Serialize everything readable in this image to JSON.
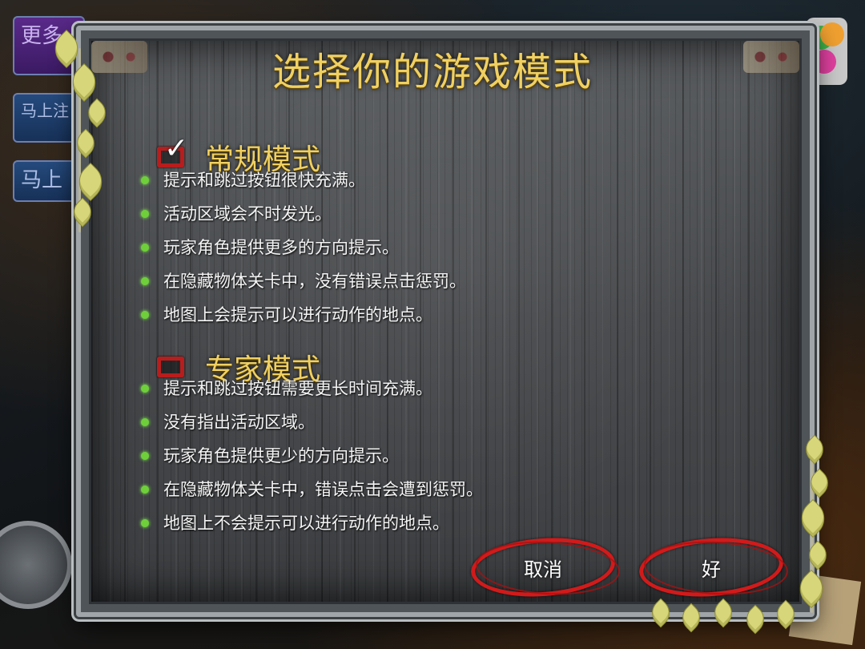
{
  "background": {
    "more_games_label": "更多",
    "register_label_1": "马上注",
    "register_label_2": "马上"
  },
  "dialog": {
    "title": "选择你的游戏模式",
    "modes": [
      {
        "label": "常规模式",
        "checked": true,
        "features": [
          "提示和跳过按钮很快充满。",
          "活动区域会不时发光。",
          "玩家角色提供更多的方向提示。",
          "在隐藏物体关卡中，没有错误点击惩罚。",
          "地图上会提示可以进行动作的地点。"
        ]
      },
      {
        "label": "专家模式",
        "checked": false,
        "features": [
          "提示和跳过按钮需要更长时间充满。",
          "没有指出活动区域。",
          "玩家角色提供更少的方向提示。",
          "在隐藏物体关卡中，错误点击会遭到惩罚。",
          "地图上不会提示可以进行动作的地点。"
        ]
      }
    ],
    "cancel_label": "取消",
    "ok_label": "好"
  },
  "colors": {
    "title_gold": "#f0d061",
    "checkbox_red": "#b81d1d",
    "bullet_green": "#6fcf3a",
    "button_ring_red": "#d21a1a"
  },
  "icons": {
    "checkmark": "checkmark-icon",
    "bullet": "bullet-dot-icon",
    "decor": "maple-leaf-icon"
  }
}
